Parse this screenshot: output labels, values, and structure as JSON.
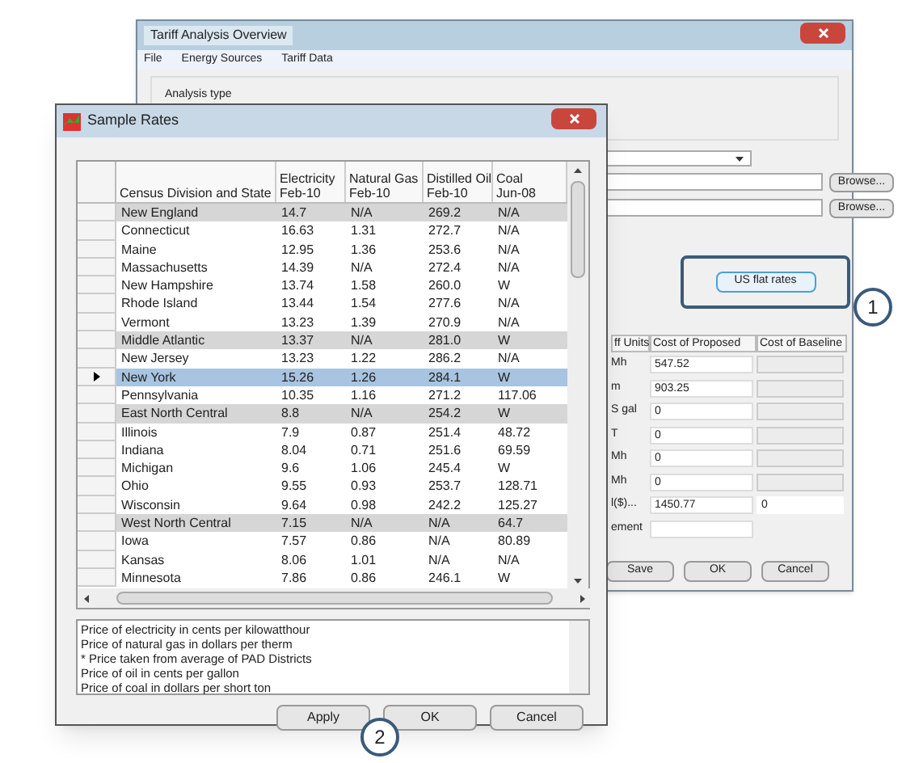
{
  "main_window": {
    "title": "Tariff Analysis Overview",
    "menu": [
      "File",
      "Energy Sources",
      "Tariff Data"
    ],
    "analysis_type_label": "Analysis type",
    "browse_buttons": [
      "Browse...",
      "Browse..."
    ],
    "flat_rates_button": "US flat rates",
    "callout_number": "1",
    "cost_table": {
      "columns": [
        "ff Units",
        "Cost of Proposed",
        "Cost of Baseline"
      ],
      "rows": [
        {
          "unit": "Mh",
          "proposed": "547.52",
          "baseline": "",
          "kind": "readonly"
        },
        {
          "unit": "m",
          "proposed": "903.25",
          "baseline": "",
          "kind": "readonly"
        },
        {
          "unit": "S gal",
          "proposed": "0",
          "baseline": "",
          "kind": "readonly"
        },
        {
          "unit": "T",
          "proposed": "0",
          "baseline": "",
          "kind": "readonly"
        },
        {
          "unit": "Mh",
          "proposed": "0",
          "baseline": "",
          "kind": "readonly"
        },
        {
          "unit": "Mh",
          "proposed": "0",
          "baseline": "",
          "kind": "readonly"
        },
        {
          "unit": "l($)...",
          "proposed": "1450.77",
          "baseline": "0",
          "kind": "total"
        },
        {
          "unit": "ement",
          "proposed": "",
          "baseline": "",
          "kind": "single"
        }
      ]
    },
    "buttons": [
      "Save",
      "OK",
      "Cancel"
    ]
  },
  "dialog": {
    "title": "Sample Rates",
    "columns": [
      {
        "line2": "Census Division and State"
      },
      {
        "line1": "Electricity",
        "line2": "Feb-10"
      },
      {
        "line1": "Natural Gas",
        "line2": "Feb-10"
      },
      {
        "line1": "Distilled Oil",
        "line2": "Feb-10"
      },
      {
        "line1": "Coal",
        "line2": "Jun-08"
      }
    ],
    "rows": [
      {
        "cells": [
          "New England",
          "14.7",
          "N/A",
          "269.2",
          "N/A"
        ],
        "kind": "region",
        "selected": false
      },
      {
        "cells": [
          "Connecticut",
          "16.63",
          "1.31",
          "272.7",
          "N/A"
        ],
        "kind": "state",
        "selected": false
      },
      {
        "cells": [
          "Maine",
          "12.95",
          "1.36",
          "253.6",
          "N/A"
        ],
        "kind": "state",
        "selected": false
      },
      {
        "cells": [
          "Massachusetts",
          "14.39",
          "N/A",
          "272.4",
          "N/A"
        ],
        "kind": "state",
        "selected": false
      },
      {
        "cells": [
          "New Hampshire",
          "13.74",
          "1.58",
          "260.0",
          "W"
        ],
        "kind": "state",
        "selected": false
      },
      {
        "cells": [
          "Rhode Island",
          "13.44",
          "1.54",
          "277.6",
          "N/A"
        ],
        "kind": "state",
        "selected": false
      },
      {
        "cells": [
          "Vermont",
          "13.23",
          "1.39",
          "270.9",
          "N/A"
        ],
        "kind": "state",
        "selected": false
      },
      {
        "cells": [
          "Middle Atlantic",
          "13.37",
          "N/A",
          "281.0",
          "W"
        ],
        "kind": "region",
        "selected": false
      },
      {
        "cells": [
          "New Jersey",
          "13.23",
          "1.22",
          "286.2",
          "N/A"
        ],
        "kind": "state",
        "selected": false
      },
      {
        "cells": [
          "New York",
          "15.26",
          "1.26",
          "284.1",
          "W"
        ],
        "kind": "state",
        "selected": true
      },
      {
        "cells": [
          "Pennsylvania",
          "10.35",
          "1.16",
          "271.2",
          "117.06"
        ],
        "kind": "state",
        "selected": false
      },
      {
        "cells": [
          "East North Central",
          "8.8",
          "N/A",
          "254.2",
          "W"
        ],
        "kind": "region",
        "selected": false
      },
      {
        "cells": [
          "Illinois",
          "7.9",
          "0.87",
          "251.4",
          "48.72"
        ],
        "kind": "state",
        "selected": false
      },
      {
        "cells": [
          "Indiana",
          "8.04",
          "0.71",
          "251.6",
          "69.59"
        ],
        "kind": "state",
        "selected": false
      },
      {
        "cells": [
          "Michigan",
          "9.6",
          "1.06",
          "245.4",
          "W"
        ],
        "kind": "state",
        "selected": false
      },
      {
        "cells": [
          "Ohio",
          "9.55",
          "0.93",
          "253.7",
          "128.71"
        ],
        "kind": "state",
        "selected": false
      },
      {
        "cells": [
          "Wisconsin",
          "9.64",
          "0.98",
          "242.2",
          "125.27"
        ],
        "kind": "state",
        "selected": false
      },
      {
        "cells": [
          "West North Central",
          "7.15",
          "N/A",
          "N/A",
          "64.7"
        ],
        "kind": "region",
        "selected": false
      },
      {
        "cells": [
          "Iowa",
          "7.57",
          "0.86",
          "N/A",
          "80.89"
        ],
        "kind": "state",
        "selected": false
      },
      {
        "cells": [
          "Kansas",
          "8.06",
          "1.01",
          "N/A",
          "N/A"
        ],
        "kind": "state",
        "selected": false
      },
      {
        "cells": [
          "Minnesota",
          "7.86",
          "0.86",
          "246.1",
          "W"
        ],
        "kind": "state",
        "selected": false
      }
    ],
    "notes": [
      "Price of electricity in cents per kilowatthour",
      "Price of natural gas in dollars per therm",
      "* Price taken from average of PAD Districts",
      "Price of oil in cents per gallon",
      "Price of coal in dollars per short ton"
    ],
    "buttons": [
      "Apply",
      "OK",
      "Cancel"
    ],
    "callout_number": "2"
  }
}
